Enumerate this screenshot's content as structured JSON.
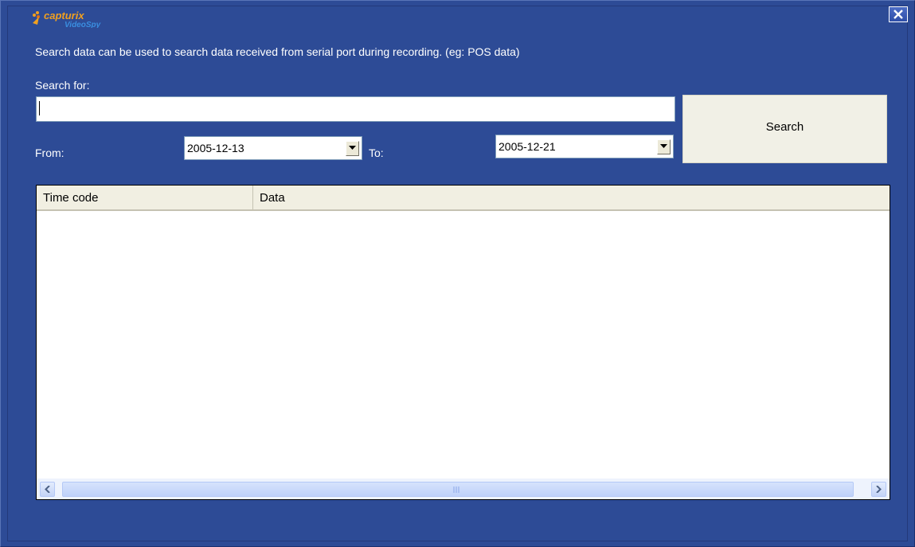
{
  "app": {
    "logo_text": "capturix VideoSpy"
  },
  "description": "Search data can be used to search data received from serial port during recording. (eg: POS data)",
  "search": {
    "label": "Search for:",
    "value": "",
    "button_label": "Search"
  },
  "date_range": {
    "from_label": "From:",
    "from_value": "2005-12-13",
    "to_label": "To:",
    "to_value": "2005-12-21"
  },
  "results": {
    "columns": [
      "Time code",
      "Data"
    ],
    "rows": []
  },
  "icons": {
    "close": "close-icon",
    "dropdown": "chevron-down-icon",
    "scroll_left": "chevron-left-icon",
    "scroll_right": "chevron-right-icon"
  },
  "colors": {
    "window_bg": "#2d4b96",
    "button_bg": "#f1f0e6",
    "header_bg": "#f1efe2"
  }
}
